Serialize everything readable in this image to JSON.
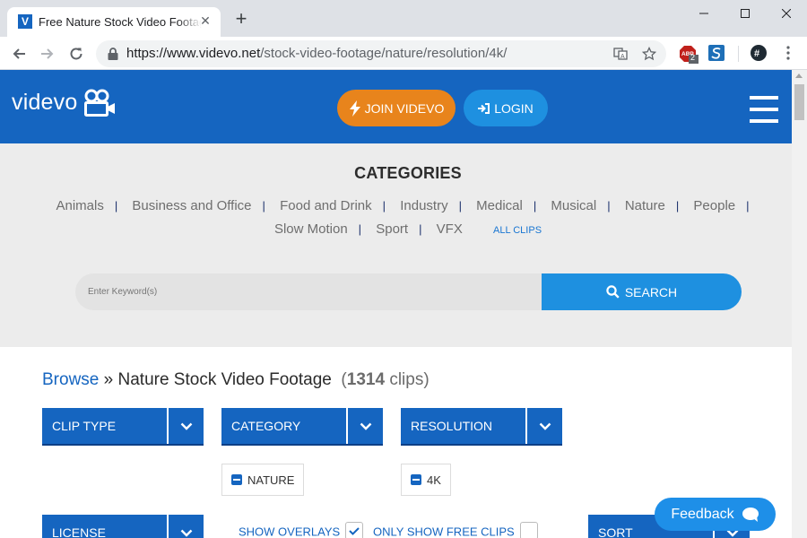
{
  "browser": {
    "tab_title": "Free Nature Stock Video Footage",
    "tab_favicon_letter": "V",
    "url_host": "https://www.videvo.net",
    "url_path": "/stock-video-footage/nature/resolution/4k/",
    "extension_badge": "2"
  },
  "header": {
    "logo_text": "videvo",
    "join_label": "JOIN VIDEVO",
    "login_label": "LOGIN",
    "brand_color": "#1565c0",
    "join_color": "#e8841c"
  },
  "categories": {
    "title": "CATEGORIES",
    "row1": [
      "Animals",
      "Business and Office",
      "Food and Drink",
      "Industry",
      "Medical",
      "Musical",
      "Nature",
      "People"
    ],
    "row2": [
      "Slow Motion",
      "Sport",
      "VFX"
    ],
    "all_clips": "ALL CLIPS"
  },
  "search": {
    "placeholder": "Enter Keyword(s)",
    "button_label": "SEARCH"
  },
  "breadcrumb": {
    "browse": "Browse",
    "separator": "»",
    "current": "Nature Stock Video Footage",
    "count": "1314",
    "count_unit": "clips"
  },
  "filters": {
    "clip_type": "CLIP TYPE",
    "category": "CATEGORY",
    "resolution": "RESOLUTION",
    "license": "LICENSE",
    "sort": "SORT"
  },
  "active_filters": {
    "category": "NATURE",
    "resolution": "4K"
  },
  "options": {
    "show_overlays": "SHOW OVERLAYS",
    "show_overlays_checked": true,
    "only_free": "ONLY SHOW FREE CLIPS",
    "only_free_checked": false
  },
  "feedback": {
    "label": "Feedback"
  }
}
